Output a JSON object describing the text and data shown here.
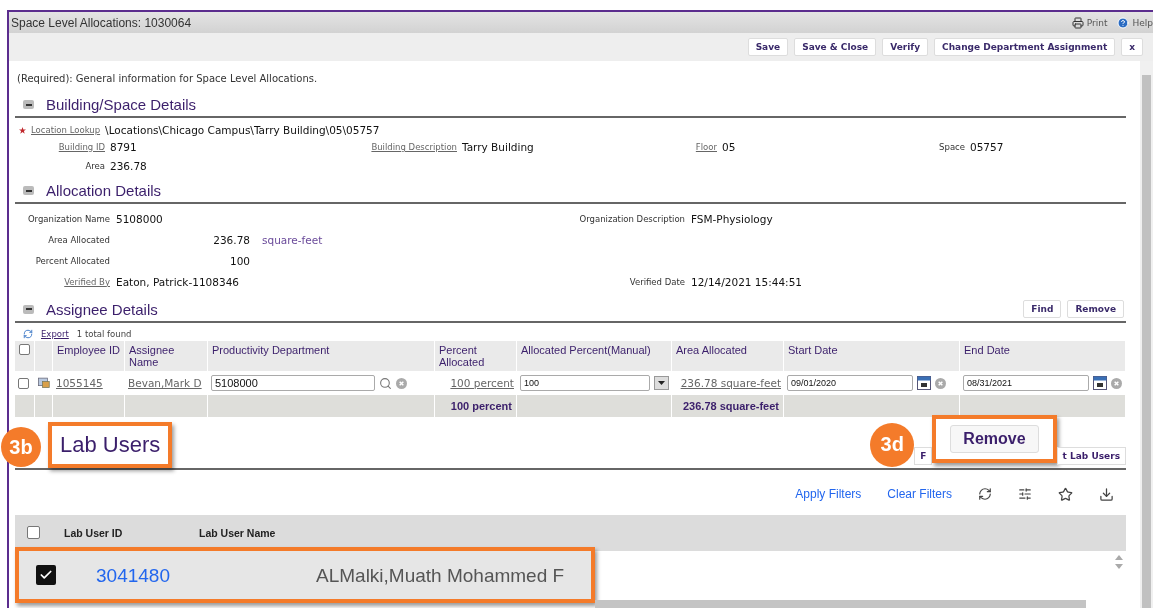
{
  "window": {
    "title": "Space Level Allocations: 1030064",
    "header_links": [
      "Print",
      "Help"
    ]
  },
  "toolbar": {
    "buttons": [
      "Save",
      "Save & Close",
      "Verify",
      "Change Department Assignment",
      "x"
    ]
  },
  "intro": "(Required): General information for Space Level Allocations.",
  "building": {
    "title": "Building/Space Details",
    "expanded": true,
    "location": {
      "label": "Location Lookup",
      "value": "\\Locations\\Chicago Campus\\Tarry Building\\05\\05757",
      "required": true
    },
    "fields": [
      {
        "label": "Building ID",
        "value": "8791",
        "link": true
      },
      {
        "label": "Building Description",
        "value": "Tarry Building",
        "link": true
      },
      {
        "label": "Floor",
        "value": "05",
        "link": true
      },
      {
        "label": "Space",
        "value": "05757",
        "link": false
      },
      {
        "label": "Area",
        "value": "236.78",
        "link": false
      }
    ]
  },
  "allocation": {
    "title": "Allocation Details",
    "expanded": true,
    "rows": [
      {
        "left": {
          "label": "Organization Name",
          "value": "5108000",
          "link": false
        },
        "right": {
          "label": "Organization Description",
          "value": "FSM-Physiology",
          "link": false
        }
      },
      {
        "left": {
          "label": "Area Allocated",
          "value": "236.78",
          "unit": "square-feet",
          "link": false,
          "kind": "measure"
        }
      },
      {
        "left": {
          "label": "Percent Allocated",
          "value": "100",
          "link": false,
          "kind": "measure"
        }
      },
      {
        "left": {
          "label": "Verified By",
          "value": "Eaton, Patrick-1108346",
          "link": true
        },
        "right": {
          "label": "Verified Date",
          "value": "12/14/2021 15:44:51",
          "link": false
        }
      }
    ]
  },
  "assignees": {
    "title": "Assignee Details",
    "expanded": true,
    "buttons": [
      "Find",
      "Remove"
    ],
    "export": "Export",
    "count": "1 total found",
    "all_checked": false,
    "columns": [
      "Employee ID",
      "Assignee Name",
      "Productivity Department",
      "Percent Allocated",
      "Allocated Percent(Manual)",
      "Area Allocated",
      "Start Date",
      "End Date"
    ],
    "rows": [
      {
        "checked": false,
        "employee_id": "1055145",
        "name": "Bevan,Mark D",
        "department": "5108000",
        "percent": "100 percent",
        "manual": "100",
        "area": "236.78 square-feet",
        "start": "09/01/2020",
        "end": "08/31/2021"
      }
    ],
    "totals": {
      "percent": "100 percent",
      "area": "236.78 square-feet"
    }
  },
  "lab_users": {
    "title": "Lab Users",
    "title_callout": "3b",
    "buttons": [
      "F",
      "t Lab Users"
    ],
    "remove_callout": {
      "badge": "3d",
      "label": "Remove"
    },
    "filters": [
      "Apply Filters",
      "Clear Filters"
    ],
    "all_checked": false,
    "columns": [
      "Lab User ID",
      "Lab User Name"
    ],
    "rows": [
      {
        "id": "3041480",
        "name": "ALMalki,Muath Mohammed F",
        "checked": true,
        "selected": true
      }
    ]
  }
}
